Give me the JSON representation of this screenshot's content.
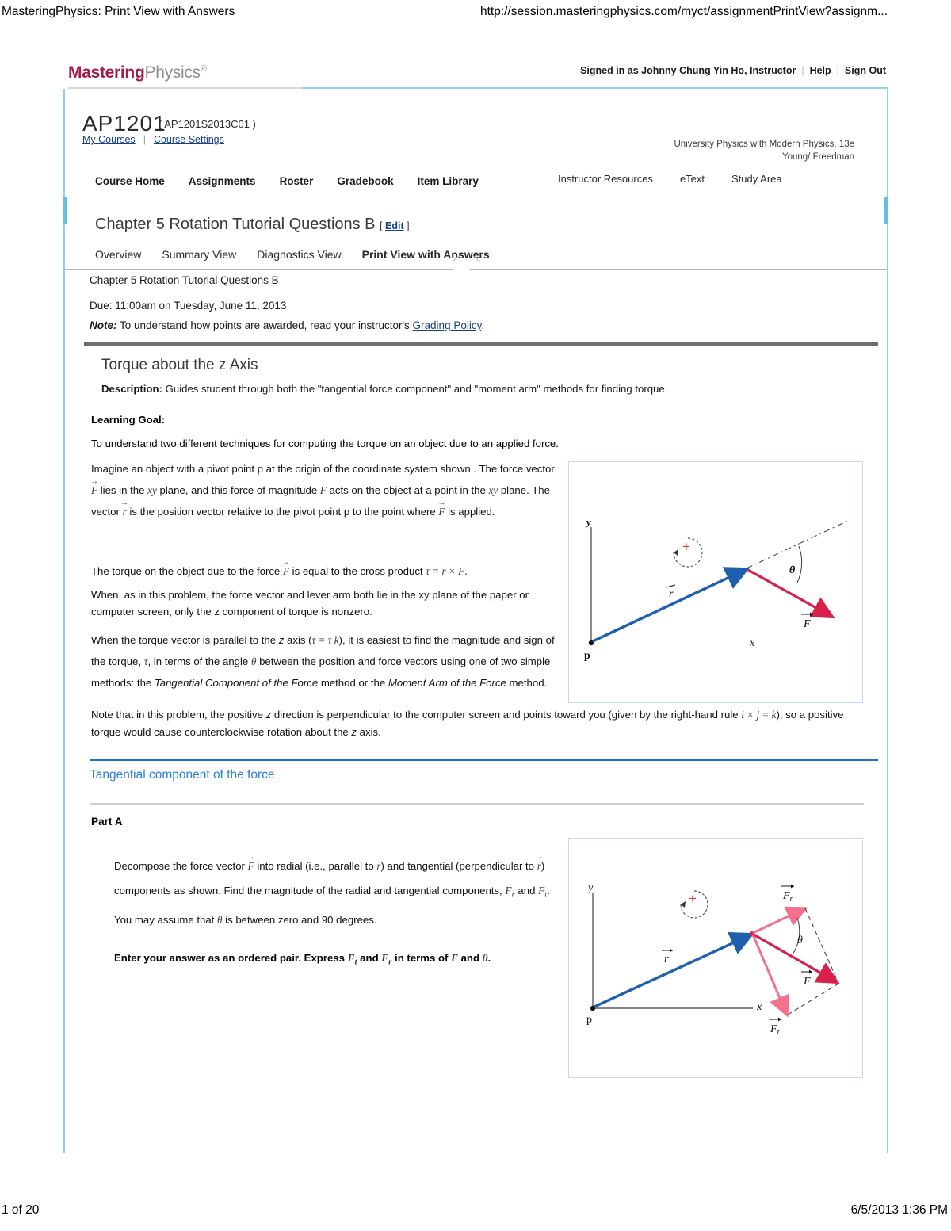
{
  "print_header": {
    "title": "MasteringPhysics: Print View with Answers",
    "url": "http://session.masteringphysics.com/myct/assignmentPrintView?assignm..."
  },
  "print_footer": {
    "page": "1 of 20",
    "timestamp": "6/5/2013 1:36 PM"
  },
  "brand": {
    "mastering": "Mastering",
    "physics": "Physics",
    "registered": "®",
    "color_mastering": "#a31a4d",
    "color_physics": "#8e8e8e"
  },
  "account_bar": {
    "signed_in_prefix": "Signed in as ",
    "user_name": "Johnny Chung Yin Ho",
    "role_suffix": ", Instructor",
    "help_label": "Help",
    "sign_out_label": "Sign Out"
  },
  "course": {
    "code": "AP1201",
    "id": "( AP1201S2013C01 )",
    "my_courses_label": "My Courses",
    "course_settings_label": "Course Settings",
    "textbook_title": "University Physics with Modern Physics, 13e",
    "textbook_authors": "Young/ Freedman"
  },
  "main_nav": {
    "items": [
      {
        "label": "Course Home"
      },
      {
        "label": "Assignments"
      },
      {
        "label": "Roster"
      },
      {
        "label": "Gradebook"
      },
      {
        "label": "Item Library"
      }
    ],
    "right_items": [
      {
        "label": "Instructor Resources"
      },
      {
        "label": "eText"
      },
      {
        "label": "Study Area"
      }
    ]
  },
  "assignment": {
    "title": "Chapter 5 Rotation Tutorial Questions B",
    "edit_open": "[ ",
    "edit_label": "Edit",
    "edit_close": " ]",
    "view_tabs": [
      {
        "label": "Overview",
        "active": false
      },
      {
        "label": "Summary View",
        "active": false
      },
      {
        "label": "Diagnostics View",
        "active": false
      },
      {
        "label": "Print View with Answers",
        "active": true
      }
    ],
    "meta_name": "Chapter 5 Rotation Tutorial Questions B",
    "meta_due": "Due: 11:00am on Tuesday, June 11, 2013",
    "note_label": "Note:",
    "note_text_before": " To understand how points are awarded, read your instructor's ",
    "note_link": "Grading Policy",
    "note_text_after": "."
  },
  "problem": {
    "title": "Torque about the z Axis",
    "description_label": "Description:",
    "description_text": " Guides student through both the \"tangential force component\" and \"moment arm\" methods for finding torque.",
    "learning_goal_label": "Learning Goal:",
    "learning_goal_text": "To understand two different techniques for computing the torque on an object due to an applied force.",
    "para1_a": "Imagine an object with a pivot point p at the origin of the coordinate system shown . The force vector ",
    "para1_b": " lies in the ",
    "para1_c": " plane, and this force of magnitude ",
    "para1_d": " acts on the object at a point in the ",
    "para1_e": " plane. The vector ",
    "para1_f": " is the position vector relative to the pivot point p to the point where ",
    "para1_g": " is applied.",
    "para2_a": "The torque on the object due to the force ",
    "para2_b": " is equal to the cross product ",
    "para2_eq": "τ = r × F",
    "para2_c": ".",
    "para3": "When, as in this problem, the force vector and lever arm both lie in the xy plane of the paper or computer screen, only the z component of torque is nonzero.",
    "para4_a": "When the torque vector is parallel to the ",
    "para4_b": " axis (",
    "para4_eq": "τ = τ k",
    "para4_c": "), it is easiest to find the magnitude and sign of the torque, ",
    "para4_d": ", in terms of the angle ",
    "para4_e": " between the position and force vectors using one of two simple methods: the ",
    "para4_m1": "Tangential Component of the Force",
    "para4_f": " method or the ",
    "para4_m2": "Moment Arm of the Force",
    "para4_g": " method.",
    "para5_a": "Note that in this problem, the positive ",
    "para5_b": " direction is perpendicular to the computer screen and points toward you (given by the right-hand rule ",
    "para5_eq": "i × j = k",
    "para5_c": "), so a positive torque would cause counterclockwise rotation about the ",
    "para5_d": " axis.",
    "symbols": {
      "F": "F",
      "r": "r",
      "tau": "τ",
      "theta": "θ",
      "z": "z",
      "xy": "xy",
      "k": "k",
      "i": "i",
      "j": "j"
    }
  },
  "section": {
    "heading": "Tangential component of the force",
    "heading_color": "#2b7fd4"
  },
  "part_a": {
    "label": "Part A",
    "q_a": "Decompose the force vector ",
    "q_b": " into radial (i.e., parallel to ",
    "q_c": ") and tangential (perpendicular to ",
    "q_d": ") components as shown. Find the magnitude of the radial and tangential components, ",
    "q_e": " and ",
    "q_f": ". You may assume that ",
    "q_g": " is between zero and 90 degrees.",
    "instr_a": "Enter your answer as an ordered pair. Express ",
    "instr_b": " and ",
    "instr_c": " in terms of ",
    "instr_d": " and ",
    "instr_e": ".",
    "sym_Fr": "F",
    "sym_Ft": "F",
    "sub_r": "r",
    "sub_t": "t"
  },
  "figure1": {
    "labels": {
      "y": "y",
      "x": "x",
      "p": "p",
      "r": "r",
      "F": "F",
      "theta": "θ",
      "plus": "+"
    },
    "colors": {
      "r_vector": "#1f5fae",
      "f_vector": "#d8204a",
      "plus": "#e0304f",
      "axis": "#5a5a5a",
      "border": "#c9d8ea"
    }
  },
  "figure2": {
    "labels": {
      "y": "y",
      "x": "x",
      "p": "p",
      "r": "r",
      "F": "F",
      "Fr": "F",
      "Ft": "F",
      "sub_r": "r",
      "sub_t": "t",
      "theta": "θ",
      "plus": "+"
    },
    "colors": {
      "r_vector": "#1f5fae",
      "f_vector": "#d8204a",
      "comp_vector": "#f4718c",
      "plus": "#e0304f",
      "axis": "#5a5a5a",
      "border": "#c9d8ea"
    }
  }
}
